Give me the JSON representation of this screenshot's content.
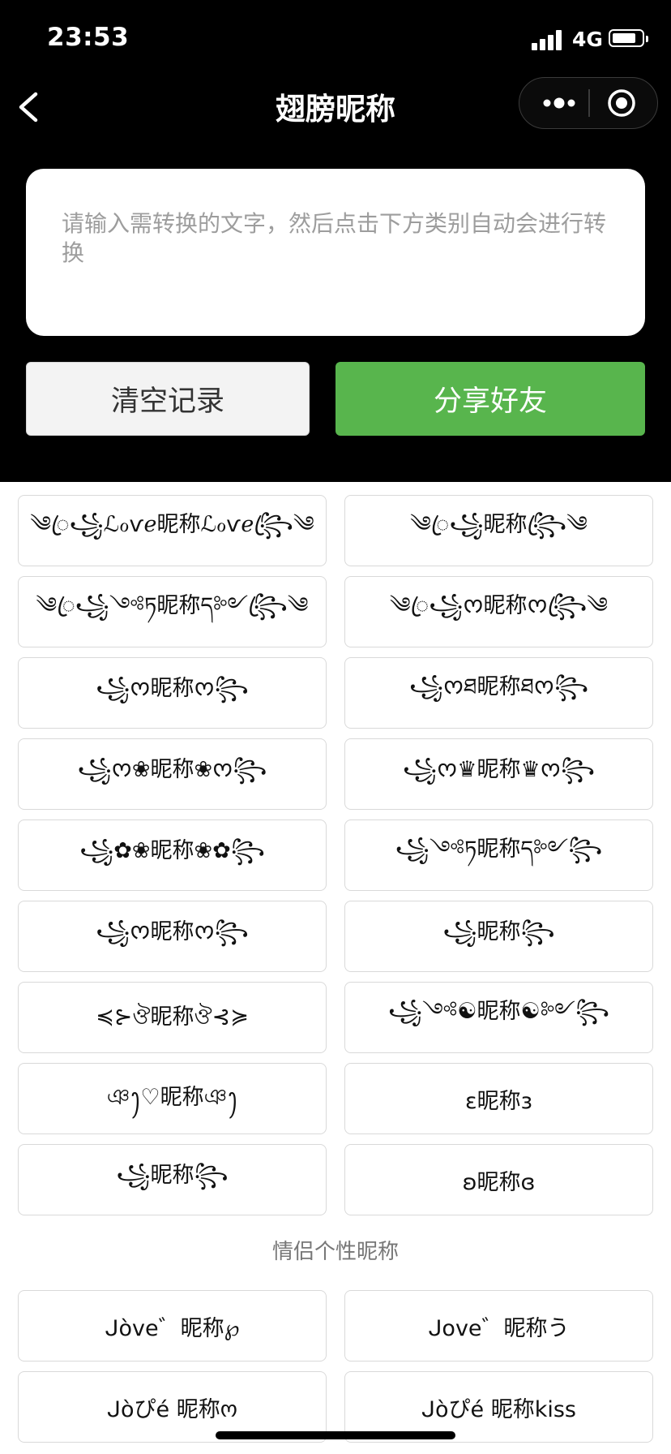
{
  "status_bar": {
    "time": "23:53",
    "network": "4G",
    "signal_icon": "signal-bars-icon",
    "battery_icon": "battery-icon"
  },
  "nav": {
    "back_icon": "chevron-left-icon",
    "title": "翅膀昵称",
    "more_icon": "more-dots-icon",
    "close_icon": "close-target-icon"
  },
  "input": {
    "value": "",
    "placeholder": "请输入需转换的文字，然后点击下方类别自动会进行转换"
  },
  "actions": {
    "clear_label": "清空记录",
    "share_label": "分享好友"
  },
  "colors": {
    "header_bg": "#000000",
    "share_button": "#58b54d",
    "clear_button": "#f3f3f3",
    "card_border": "#d9d9d9"
  },
  "nickname_styles": [
    "༄ꦿ꧁ℒℴѵℯ昵称ℒℴѵℯ꧂ꦿ༄",
    "༄ꦿ꧁昵称꧂ꦿ༄",
    "༄ꦿ꧁༺ཏ昵称ད༻꧂ꦿ༄",
    "༄ꦿ꧁ᰔ昵称ᰔ꧂ꦿ༄",
    "꧁ᰔ昵称ᰔ꧂",
    "꧁ᰔཐ昵称ཐᰔ꧂",
    "꧁ᰔ❀昵称❀ᰔ꧂",
    "꧁ᰔ♛昵称♛ᰔ꧂",
    "꧁✿❀昵称❀✿꧂",
    "꧁༺ཏ昵称ད༻꧂",
    "꧁ᰔ昵称ᰔ꧂",
    "꧁昵称꧂",
    "≼⊱ঔ昵称ঔ⊰≽",
    "꧁༺☯昵称☯༻꧂",
    "ঞꫂ♡昵称ঞꫂ",
    "ɛ昵称ɜ",
    "꧁昵称꧂",
    "ʚ昵称ɞ"
  ],
  "couple_section_title": "情侣个性昵称",
  "couple_styles": [
    "ᒍòve゛昵称℘",
    "ᒍove゛昵称う",
    "ᒍòぴé 昵称ო",
    "ᒍòぴé 昵称kiss"
  ]
}
